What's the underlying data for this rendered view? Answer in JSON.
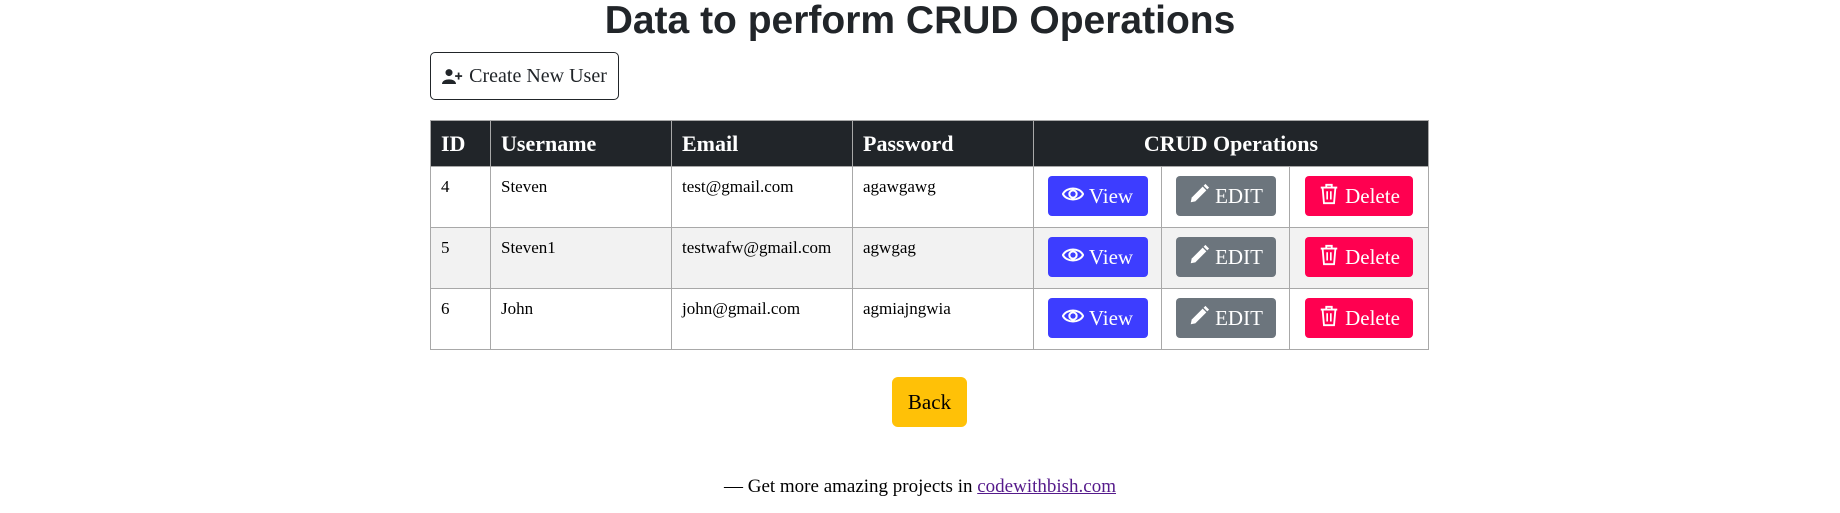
{
  "page": {
    "title": "Data to perform CRUD Operations"
  },
  "toolbar": {
    "create_label": "Create New User"
  },
  "table": {
    "headers": [
      "ID",
      "Username",
      "Email",
      "Password",
      "CRUD Operations"
    ],
    "rows": [
      {
        "id": "4",
        "username": "Steven",
        "email": "test@gmail.com",
        "password": "agawgawg"
      },
      {
        "id": "5",
        "username": "Steven1",
        "email": "testwafw@gmail.com",
        "password": "agwgag"
      },
      {
        "id": "6",
        "username": "John",
        "email": "john@gmail.com",
        "password": "agmiajngwia"
      }
    ],
    "actions": {
      "view": "View",
      "edit": "EDIT",
      "delete": "Delete"
    }
  },
  "back_label": "Back",
  "footer": {
    "prefix": "— Get more amazing projects in",
    "link": "codewithbish.com"
  },
  "colors": {
    "header_bg": "#212529",
    "view": "#3d3dff",
    "edit": "#6c757d",
    "delete": "#ff0050",
    "back": "#ffc107"
  },
  "icons": {
    "create": "user-plus-icon",
    "view": "eye-icon",
    "edit": "pencil-icon",
    "delete": "trash-icon"
  }
}
